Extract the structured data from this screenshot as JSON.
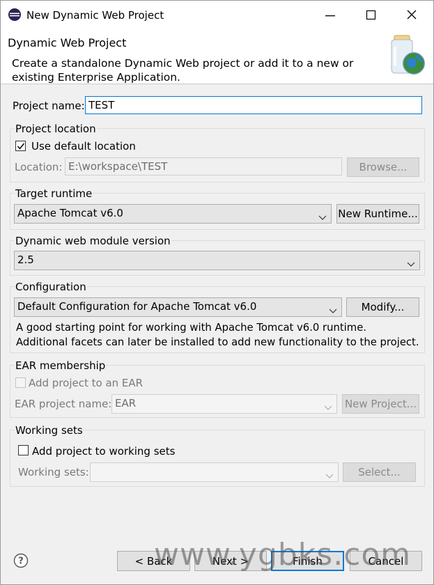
{
  "window": {
    "title": "New Dynamic Web Project"
  },
  "banner": {
    "title": "Dynamic Web Project",
    "description": "Create a standalone Dynamic Web project or add it to a new or existing Enterprise Application."
  },
  "project_name": {
    "label": "Project name:",
    "value": "TEST"
  },
  "project_location": {
    "title": "Project location",
    "use_default_label": "Use default location",
    "use_default_checked": true,
    "location_label": "Location:",
    "location_value": "E:\\workspace\\TEST",
    "browse_label": "Browse..."
  },
  "target_runtime": {
    "title": "Target runtime",
    "selected": "Apache Tomcat v6.0",
    "new_runtime_label": "New Runtime..."
  },
  "module_version": {
    "title": "Dynamic web module version",
    "selected": "2.5"
  },
  "configuration": {
    "title": "Configuration",
    "selected": "Default Configuration for Apache Tomcat v6.0",
    "modify_label": "Modify...",
    "description_line1": "A good starting point for working with Apache Tomcat v6.0 runtime.",
    "description_line2": "Additional facets can later be installed to add new functionality to the project."
  },
  "ear_membership": {
    "title": "EAR membership",
    "add_label": "Add project to an EAR",
    "project_name_label": "EAR project name:",
    "project_name_value": "EAR",
    "new_project_label": "New Project..."
  },
  "working_sets": {
    "title": "Working sets",
    "add_label": "Add project to working sets",
    "sets_label": "Working sets:",
    "select_label": "Select..."
  },
  "footer": {
    "back_label": "< Back",
    "next_label": "Next >",
    "finish_label": "Finish",
    "cancel_label": "Cancel",
    "watermark": "www.ygbks.com"
  },
  "colors": {
    "accent": "#0078d7",
    "window_bg": "#f0f0f0"
  }
}
